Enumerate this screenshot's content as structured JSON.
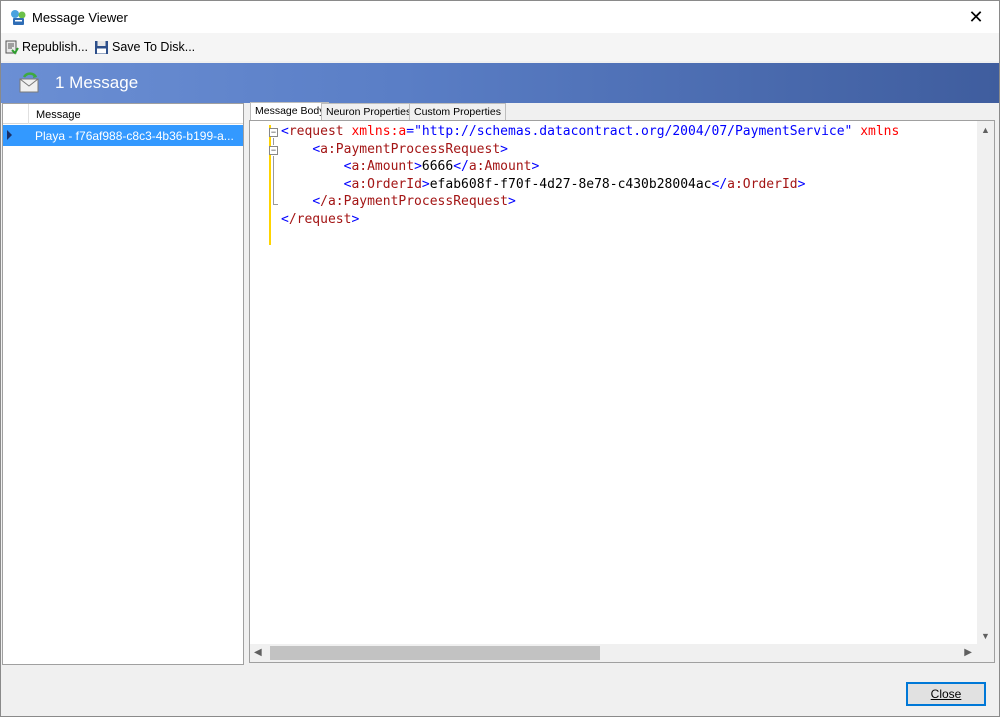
{
  "window": {
    "title": "Message Viewer",
    "close_glyph": "✕"
  },
  "toolbar": {
    "republish_label": "Republish...",
    "save_label": "Save To Disk..."
  },
  "banner": {
    "title": "1 Message"
  },
  "message_list": {
    "column_header": "Message",
    "rows": [
      {
        "text": "Playa - f76af988-c8c3-4b36-b199-a...",
        "selected": true
      }
    ]
  },
  "tabs": [
    {
      "label": "Message Body",
      "active": true
    },
    {
      "label": "Neuron Properties",
      "active": false
    },
    {
      "label": "Custom Properties",
      "active": false
    }
  ],
  "editor": {
    "root_open_tag": "request",
    "root_attr_name": "xmlns:a",
    "root_attr_value": "\"http://schemas.datacontract.org/2004/07/PaymentService\"",
    "root_attr2": "xmlns",
    "child_tag": "a:PaymentProcessRequest",
    "amount_tag": "a:Amount",
    "amount_value": "6666",
    "orderid_tag": "a:OrderId",
    "orderid_value": "efab608f-f70f-4d27-8e78-c430b28004ac",
    "child_close_tag": "/a:PaymentProcessRequest",
    "root_close_tag": "/request"
  },
  "footer": {
    "close_label": "Close"
  },
  "colors": {
    "banner_start": "#6b8fd4",
    "banner_end": "#3f5d9e",
    "selection": "#3399ff",
    "xml_bracket": "#0000ff",
    "xml_element": "#a31515",
    "xml_attribute": "#ff0000"
  }
}
